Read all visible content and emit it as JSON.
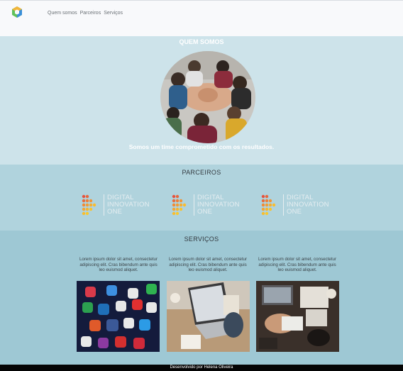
{
  "header": {
    "logo_icon": "cube-logo-icon",
    "nav": [
      "Quem somos",
      "Parceiros",
      "Serviços"
    ]
  },
  "quem_somos": {
    "title": "QUEM SOMOS",
    "caption": "Somos um time comprometido com os resultados."
  },
  "parceiros": {
    "title": "PARCEIROS",
    "partners": [
      {
        "line1": "DIGITAL",
        "line2": "INNOVATION",
        "line3": "ONE"
      },
      {
        "line1": "DIGITAL",
        "line2": "INNOVATION",
        "line3": "ONE"
      },
      {
        "line1": "DIGITAL",
        "line2": "INNOVATION",
        "line3": "ONE"
      }
    ]
  },
  "servicos": {
    "title": "SERVIÇOS",
    "items": [
      {
        "text": "Lorem ipsum dolor sit amet, consectetur adipiscing elit. Cras bibendum ante quis leo euismod aliquet.",
        "image": "social-media-apps-photo"
      },
      {
        "text": "Lorem ipsum dolor sit amet, consectetur adipiscing elit. Cras bibendum ante quis leo euismod aliquet.",
        "image": "laptop-desk-photo"
      },
      {
        "text": "Lorem ipsum dolor sit amet, consectetur adipiscing elit. Cras bibendum ante quis leo euismod aliquet.",
        "image": "workspace-topdown-photo"
      }
    ]
  },
  "footer": {
    "text": "Desenvolvido por Helena Oliveira"
  },
  "colors": {
    "quem_bg": "#cde3ea",
    "parceiros_bg": "#b0d3dd",
    "servicos_bg": "#9ec8d4",
    "footer_bg": "#050505"
  }
}
